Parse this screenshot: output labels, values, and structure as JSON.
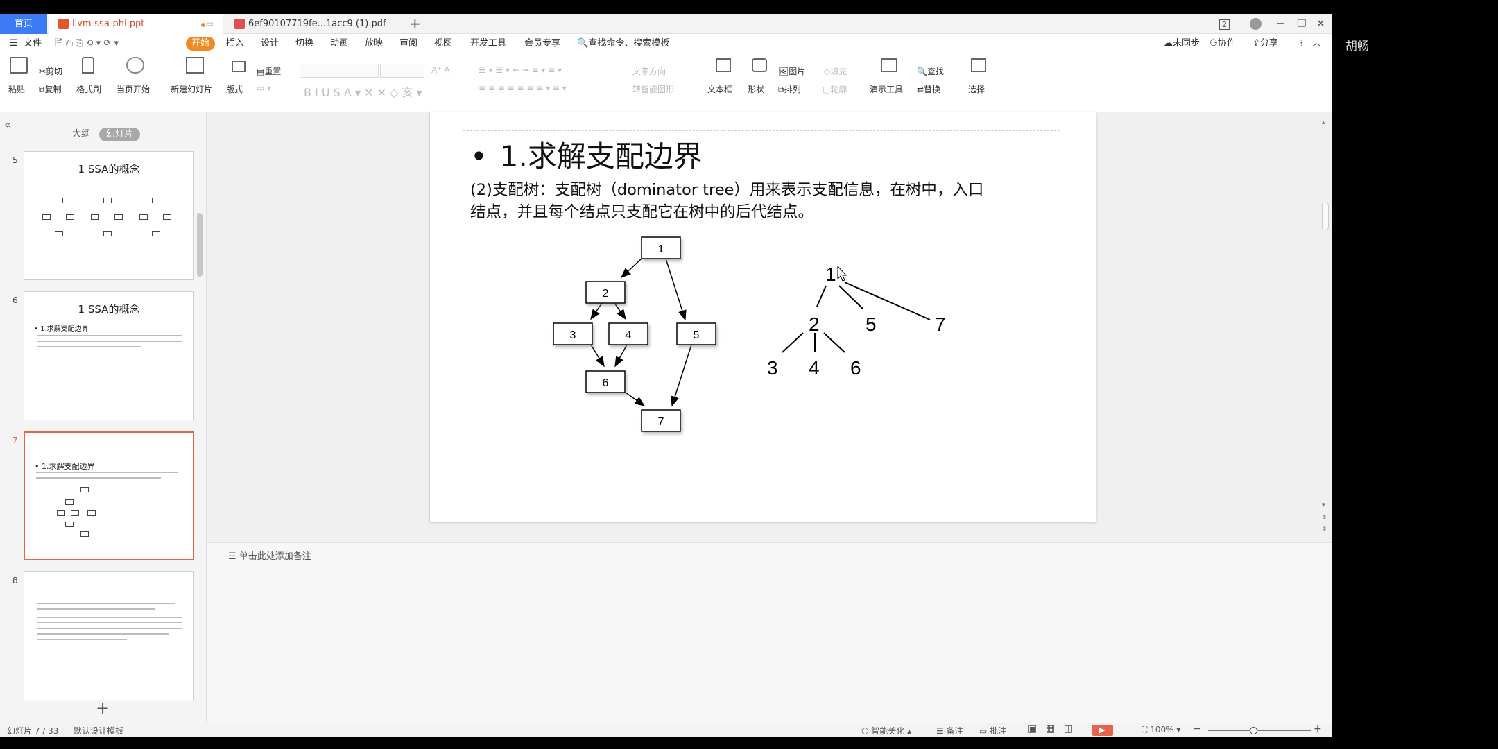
{
  "tabbar": {
    "home": "首页",
    "tabs": [
      {
        "label": "llvm-ssa-phi.ppt"
      },
      {
        "label": "6ef90107719fe...1acc9 (1).pdf"
      }
    ],
    "page_badge": "2"
  },
  "menu": {
    "file": "文件",
    "items": [
      "开始",
      "插入",
      "设计",
      "切换",
      "动画",
      "放映",
      "审阅",
      "视图",
      "开发工具",
      "会员专享"
    ],
    "search": "查找命令、搜索模板",
    "right": [
      "未同步",
      "协作",
      "分享"
    ]
  },
  "ribbon": {
    "paste": "粘贴",
    "cut": "剪切",
    "copy": "复制",
    "format_painter": "格式刷",
    "from_current": "当页开始",
    "new_slide": "新建幻灯片",
    "layout": "版式",
    "reset": "重置",
    "text_direction": "文字方向",
    "align_text": "对齐文本",
    "smart_graphic": "转智能图形",
    "textbox": "文本框",
    "shape": "形状",
    "picture": "图片",
    "fill": "填充",
    "arrange": "排列",
    "outline": "轮廓",
    "presenter_tools": "演示工具",
    "find": "查找",
    "replace": "替换",
    "select": "选择"
  },
  "left_panel": {
    "tab_outline": "大纲",
    "tab_slides": "幻灯片",
    "thumbs": [
      {
        "num": "5",
        "title": "1 SSA的概念"
      },
      {
        "num": "6",
        "title": "1 SSA的概念",
        "line": "• 1.求解支配边界"
      },
      {
        "num": "7",
        "line": "• 1.求解支配边界"
      },
      {
        "num": "8"
      }
    ]
  },
  "slide": {
    "bullet": "•",
    "title": "1.求解支配边界",
    "body": "(2)支配树：支配树（dominator tree）用来表示支配信息，在树中，入口结点，并且每个结点只支配它在树中的后代结点。",
    "cfg_nodes": [
      "1",
      "2",
      "3",
      "4",
      "5",
      "6",
      "7"
    ],
    "tree_nodes": [
      "1",
      "2",
      "5",
      "7",
      "3",
      "4",
      "6"
    ]
  },
  "notes": {
    "placeholder": "单击此处添加备注"
  },
  "status": {
    "slide_pos": "幻灯片 7 / 33",
    "template": "默认设计模板",
    "beautify": "智能美化",
    "notes": "备注",
    "comments": "批注",
    "zoom": "100%"
  },
  "user": {
    "name": "胡畅"
  },
  "colors": {
    "accent": "#f08a24",
    "tab_active": "#3b7cf5",
    "selection": "#e8614a"
  }
}
